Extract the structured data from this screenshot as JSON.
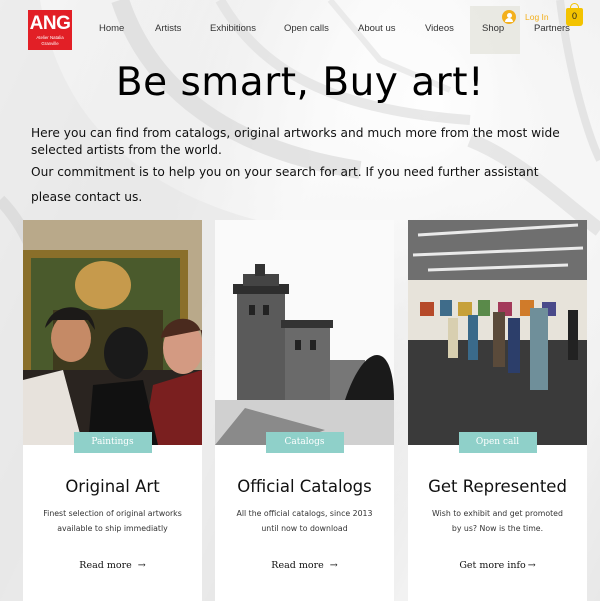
{
  "logo": {
    "big": "ANG",
    "small": "Atelier Natalia Granville"
  },
  "nav": {
    "items": [
      {
        "label": "Home"
      },
      {
        "label": "Artists"
      },
      {
        "label": "Exhibitions"
      },
      {
        "label": "Open calls"
      },
      {
        "label": "About us"
      },
      {
        "label": "Videos"
      },
      {
        "label": "Shop"
      },
      {
        "label": "Partners"
      }
    ],
    "login_label": "Log In",
    "cart_count": "0"
  },
  "hero": {
    "title": "Be smart, Buy art!",
    "intro_1": "Here you can find from catalogs, original artworks and much more from the most wide selected artists from the world.",
    "intro_2": "Our commitment is to help you on your search for art. If you need further assistant",
    "intro_3": "please contact us."
  },
  "cards": [
    {
      "badge": "Paintings",
      "title": "Original Art",
      "desc": "Finest selection of original artworks available to ship immediatly",
      "link": "Read more"
    },
    {
      "badge": "Catalogs",
      "title": "Official Catalogs",
      "desc": "All the official catalogs, since 2013 until now to download",
      "link": "Read more"
    },
    {
      "badge": "Open call",
      "title": "Get Represented",
      "desc": "Wish to exhibit and get promoted by us? Now is the time.",
      "link": "Get more info"
    }
  ],
  "colors": {
    "accent": "#8fd0c9",
    "logo": "#e21f26",
    "cart": "#f3c300",
    "login": "#f3b01c"
  }
}
